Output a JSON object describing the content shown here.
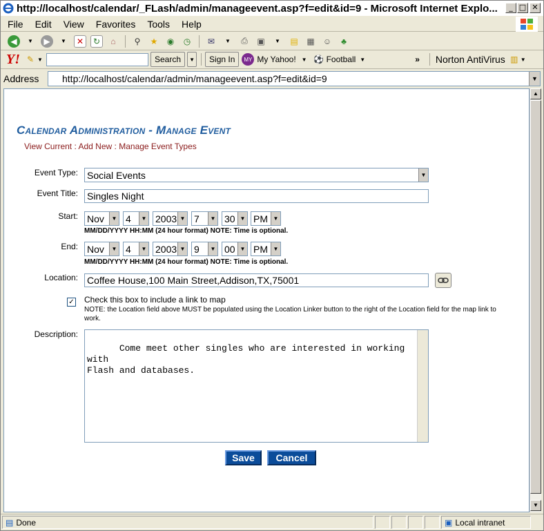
{
  "window": {
    "title": "http://localhost/calendar/_FLash/admin/manageevent.asp?f=edit&id=9 - Microsoft Internet Explo...",
    "min": "_",
    "max": "□",
    "close": "✕"
  },
  "menu": [
    "File",
    "Edit",
    "View",
    "Favorites",
    "Tools",
    "Help"
  ],
  "yahoo": {
    "search_label": "Search",
    "signin_label": "Sign In",
    "myyahoo_label": "My Yahoo!",
    "football_label": "Football",
    "antivirus_label": "Norton AntiVirus"
  },
  "address": {
    "label": "Address",
    "url": "http://localhost/calendar/admin/manageevent.asp?f=edit&id=9"
  },
  "page": {
    "title": "Calendar Administration - Manage Event",
    "nav": {
      "view_current": "View Current",
      "sep": ":",
      "add_new": "Add New",
      "manage_types": "Manage Event Types"
    },
    "event_type_label": "Event Type:",
    "event_type_value": "Social Events",
    "event_title_label": "Event Title:",
    "event_title_value": "Singles Night",
    "start_label": "Start:",
    "start": {
      "month": "Nov",
      "day": "4",
      "year": "2003",
      "hour": "7",
      "minute": "30",
      "ampm": "PM"
    },
    "end_label": "End:",
    "end": {
      "month": "Nov",
      "day": "4",
      "year": "2003",
      "hour": "9",
      "minute": "00",
      "ampm": "PM"
    },
    "format_note": "MM/DD/YYYY HH:MM (24 hour format) NOTE: Time is optional.",
    "location_label": "Location:",
    "location_value": "Coffee House,100 Main Street,Addison,TX,75001",
    "map_check_label": "Check this box to include a link to map",
    "map_note": "NOTE: the Location field above MUST be populated using the Location Linker button to the right of the Location field for the map link to work.",
    "description_label": "Description:",
    "description_value": "Come meet other singles who are interested in working with\nFlash and databases.",
    "save_label": "Save",
    "cancel_label": "Cancel"
  },
  "status": {
    "text": "Done",
    "zone": "Local intranet"
  },
  "colors": {
    "accent": "#1f5c9e",
    "link": "#8a1a1a",
    "button": "#0b4c9a"
  }
}
